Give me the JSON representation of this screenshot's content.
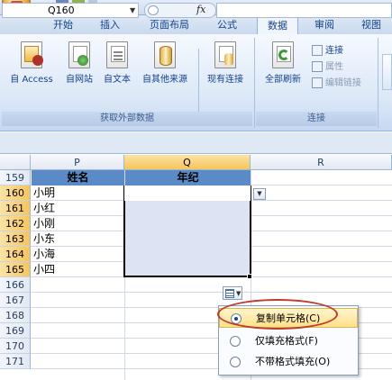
{
  "tabs": [
    "开始",
    "插入",
    "页面布局",
    "公式",
    "数据",
    "审阅",
    "视图"
  ],
  "active_tab": "数据",
  "ribbon": {
    "external_group": {
      "buttons": [
        "自 Access",
        "自网站",
        "自文本",
        "自其他来源",
        "现有连接"
      ],
      "label": "获取外部数据"
    },
    "connections_group": {
      "refresh_label": "全部刷新",
      "items": [
        "连接",
        "属性",
        "编辑链接"
      ],
      "label": "连接"
    }
  },
  "formula_bar": {
    "name_box": "Q160",
    "fx": "fx",
    "formula": ""
  },
  "columns": [
    "P",
    "Q",
    "R"
  ],
  "rows": [
    "159",
    "160",
    "161",
    "162",
    "163",
    "164",
    "165",
    "166",
    "167",
    "168",
    "169",
    "170",
    "171"
  ],
  "table": {
    "headers": [
      "姓名",
      "年纪"
    ],
    "names": [
      "小明",
      "小红",
      "小刚",
      "小东",
      "小海",
      "小四"
    ]
  },
  "paste_menu": {
    "options": [
      "复制单元格(C)",
      "仅填充格式(F)",
      "不带格式填充(O)"
    ],
    "selected_index": 0
  },
  "colors": {
    "ribbon_text": "#15428b",
    "header_fill": "#5a8bc7",
    "selection_fill": "#dde3f2",
    "highlight_ring": "#c0392b"
  }
}
